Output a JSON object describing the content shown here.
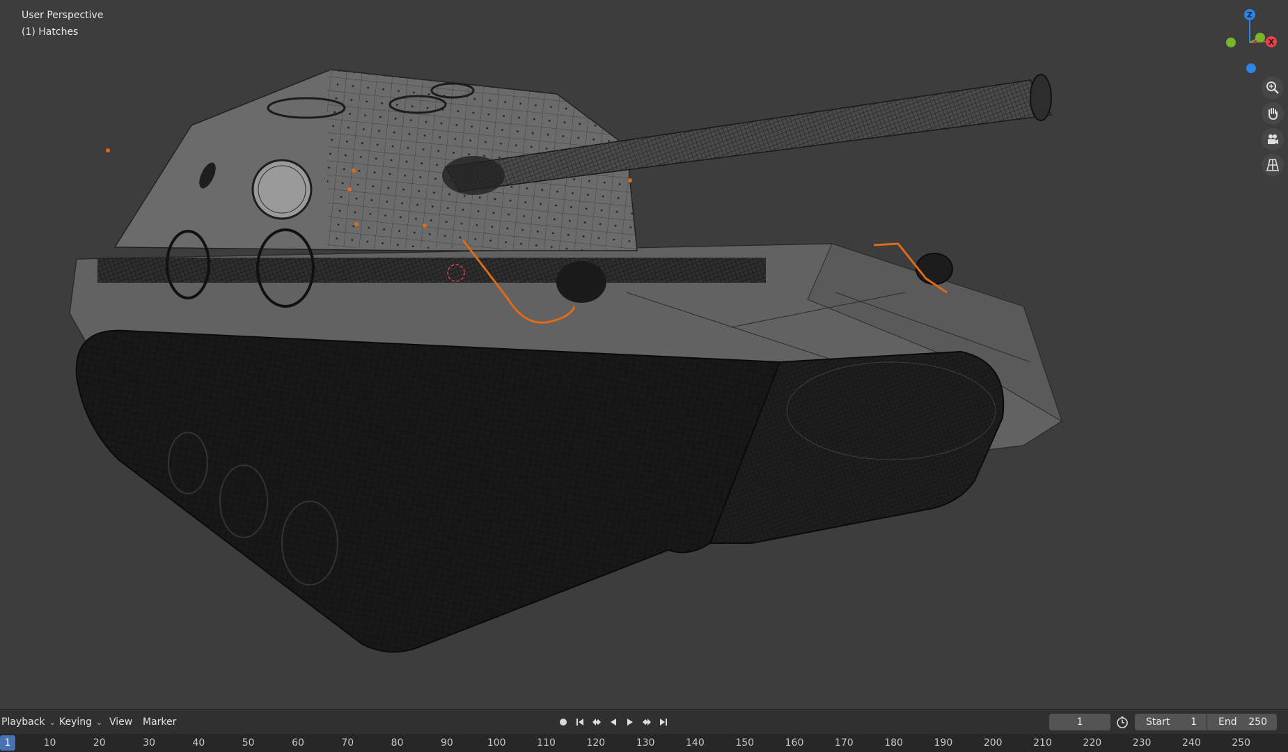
{
  "viewport": {
    "info_line1": "User Perspective",
    "info_line2": "(1) Hatches",
    "background": "#3d3d3d",
    "selection_color": "#e06a1a"
  },
  "gizmo": {
    "axis_z_label": "Z",
    "axis_x_label": "X",
    "axis_z_color": "#2f83e6",
    "axis_x_color": "#e0454f",
    "axis_y_color": "#79b52b"
  },
  "nav_tools": [
    "zoom-icon",
    "hand-pan-icon",
    "camera-icon",
    "perspective-grid-icon"
  ],
  "timeline": {
    "menus": [
      "Playback",
      "Keying",
      "View",
      "Marker"
    ],
    "current_frame": "1",
    "start_label": "Start",
    "start_value": "1",
    "end_label": "End",
    "end_value": "250",
    "ruler_labels": [
      "10",
      "20",
      "30",
      "40",
      "50",
      "60",
      "70",
      "80",
      "90",
      "100",
      "110",
      "120",
      "130",
      "140",
      "150",
      "160",
      "170",
      "180",
      "190",
      "200",
      "210",
      "220",
      "230",
      "240",
      "250"
    ],
    "ruler_current": "1",
    "accent": "#4772b3"
  }
}
